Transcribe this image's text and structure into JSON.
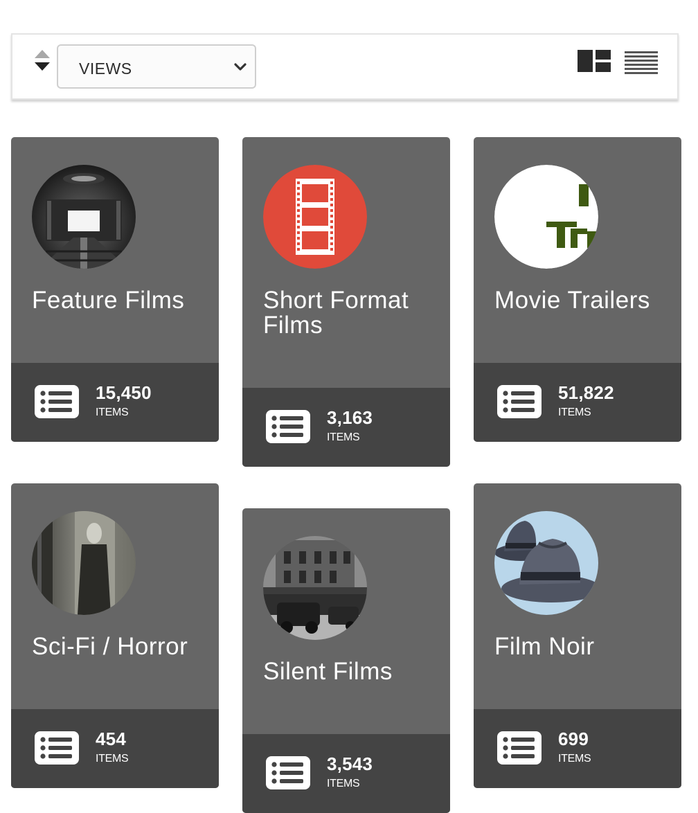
{
  "toolbar": {
    "sort_icon": "sort-up-down-icon",
    "views_label": "VIEWS",
    "dropdown_icon": "chevron-down-icon",
    "tile_view_icon": "tile-view-icon",
    "list_view_icon": "list-view-icon"
  },
  "colors": {
    "card_body": "#666666",
    "card_footer": "#444444",
    "red_badge": "#e04a3a"
  },
  "collections": [
    {
      "title": "Feature Films",
      "count": "15,450",
      "items_label": "ITEMS",
      "image": "movie-theater-interior"
    },
    {
      "title": "Short Format Films",
      "count": "3,163",
      "items_label": "ITEMS",
      "image": "film-strip-icon"
    },
    {
      "title": "Movie Trailers",
      "count": "51,822",
      "items_label": "ITEMS",
      "image": "movie-trailers-logo"
    },
    {
      "title": "Sci-Fi / Horror",
      "count": "454",
      "items_label": "ITEMS",
      "image": "nosferatu-still"
    },
    {
      "title": "Silent Films",
      "count": "3,543",
      "items_label": "ITEMS",
      "image": "movietone-theater-street"
    },
    {
      "title": "Film Noir",
      "count": "699",
      "items_label": "ITEMS",
      "image": "fedora-hats"
    }
  ]
}
